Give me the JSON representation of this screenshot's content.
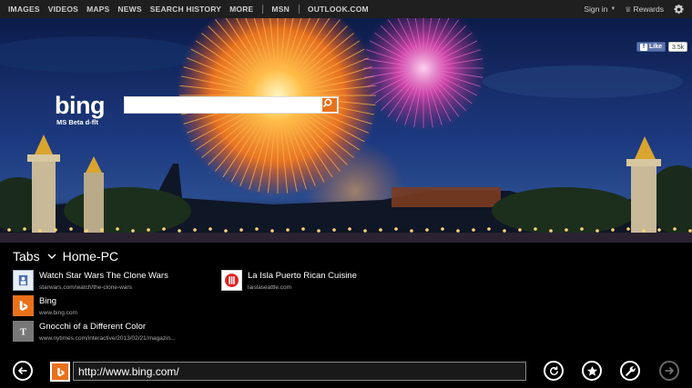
{
  "nav": {
    "items": [
      "IMAGES",
      "VIDEOS",
      "MAPS",
      "NEWS",
      "SEARCH HISTORY",
      "MORE"
    ],
    "secondary": [
      "MSN",
      "OUTLOOK.COM"
    ],
    "signin": "Sign in",
    "rewards": "Rewards"
  },
  "facebook": {
    "like": "Like",
    "count": "3.5k"
  },
  "search": {
    "logo": "bing",
    "subtitle": "MS Beta d-flt",
    "placeholder": ""
  },
  "tabs": {
    "title": "Tabs",
    "device": "Home-PC",
    "items": [
      {
        "title": "Watch Star Wars The Clone Wars",
        "url": "starwars.com/watch/the-clone-wars",
        "icon": "starwars-icon"
      },
      {
        "title": "Bing",
        "url": "www.bing.com",
        "icon": "bing-icon"
      },
      {
        "title": "Gnocchi of a Different Color",
        "url": "www.nytimes.com/interactive/2013/02/21/magazin...",
        "icon": "nytimes-icon"
      },
      {
        "title": "La Isla Puerto Rican Cuisine",
        "url": "laislaseattle.com",
        "icon": "la-isla-icon"
      }
    ]
  },
  "addressbar": {
    "url": "http://www.bing.com/"
  },
  "colors": {
    "accent": "#e9711c",
    "navbar": "#1f1f1f",
    "background": "#000000"
  }
}
